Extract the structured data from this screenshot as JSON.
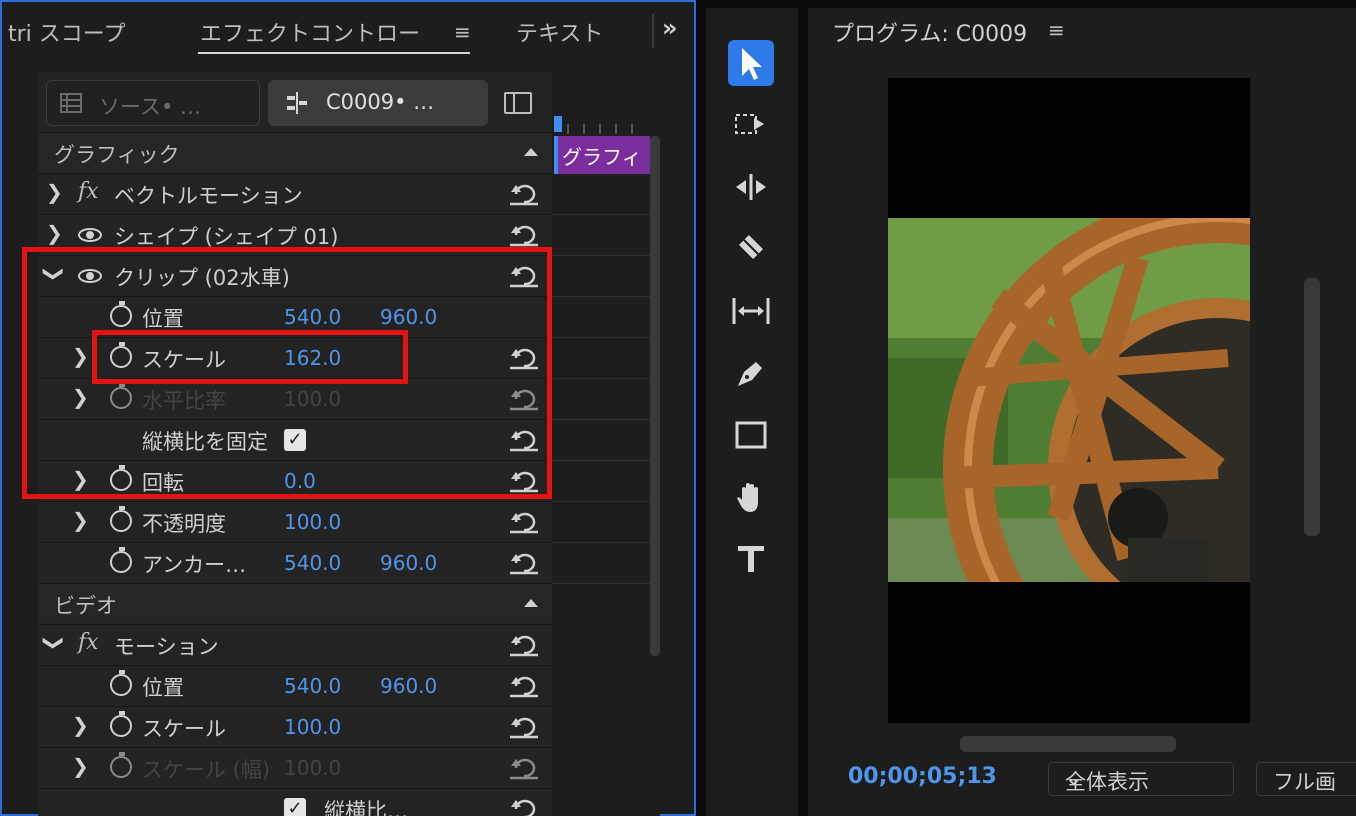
{
  "tabs": {
    "scopes": "tri スコープ",
    "effect_controls": "エフェクトコントロー",
    "text": "テキスト",
    "overflow": "»",
    "menu": "≡"
  },
  "header": {
    "source_label": "ソース• …",
    "sequence_label": "C0009• …"
  },
  "sections": {
    "graphic": "グラフィック",
    "video": "ビデオ"
  },
  "rows": {
    "vector_motion": "ベクトルモーション",
    "shape": "シェイプ (シェイプ 01)",
    "clip": "クリップ (02水車)",
    "clip_position": {
      "label": "位置",
      "x": "540.0",
      "y": "960.0"
    },
    "clip_scale": {
      "label": "スケール",
      "value": "162.0"
    },
    "clip_h_ratio": {
      "label": "水平比率",
      "value": "100.0"
    },
    "clip_lock_aspect": {
      "label": "縦横比を固定",
      "checked": true
    },
    "clip_rotation": {
      "label": "回転",
      "value": "0.0"
    },
    "clip_opacity": {
      "label": "不透明度",
      "value": "100.0"
    },
    "clip_anchor": {
      "label": "アンカー…",
      "x": "540.0",
      "y": "960.0"
    },
    "motion": "モーション",
    "motion_position": {
      "label": "位置",
      "x": "540.0",
      "y": "960.0"
    },
    "motion_scale": {
      "label": "スケール",
      "value": "100.0"
    },
    "motion_scale_width": {
      "label": "スケール (幅)",
      "value": "100.0"
    },
    "motion_lock_aspect": {
      "label": "縦横比…",
      "checked": true
    }
  },
  "timeline": {
    "clip_label": "グラフィ"
  },
  "tools": [
    "selection-tool",
    "track-select-tool",
    "ripple-edit-tool",
    "razor-tool",
    "slip-tool",
    "pen-tool",
    "rectangle-tool",
    "hand-tool",
    "type-tool"
  ],
  "program": {
    "title": "プログラム: C0009",
    "menu": "≡",
    "timecode": "00;00;05;13",
    "zoom": "全体表示",
    "resolution": "フル画"
  },
  "colors": {
    "accent_blue": "#2d7ae8",
    "value_blue": "#4f95ea",
    "highlight_red": "#e41313",
    "clip_purple": "#7b2d9e"
  }
}
